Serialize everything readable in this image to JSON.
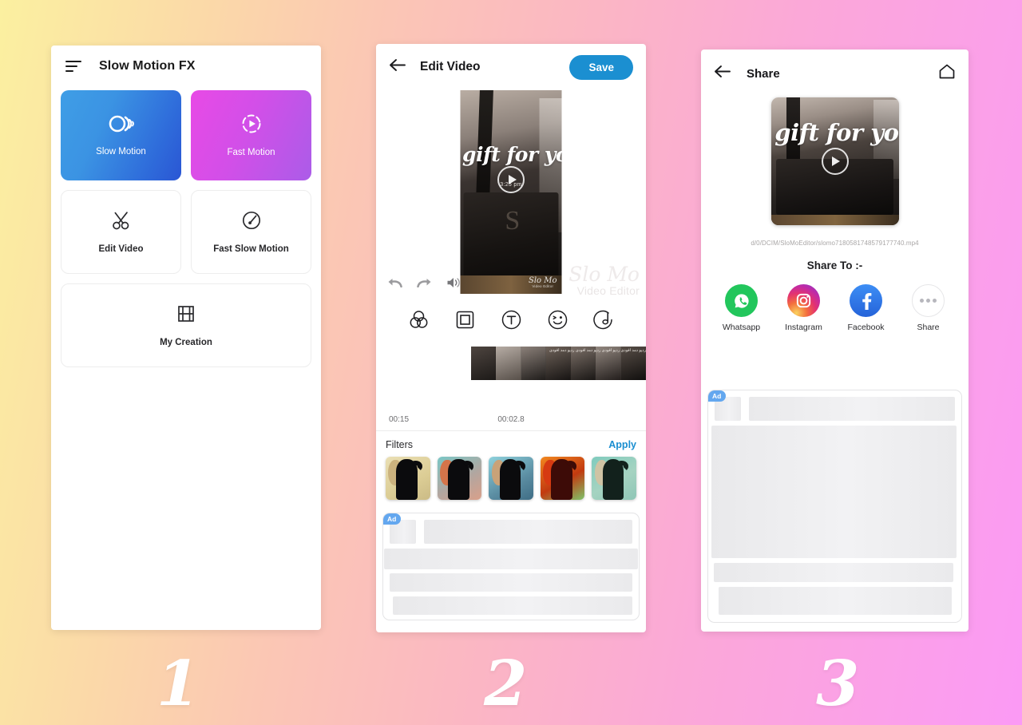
{
  "background": {
    "gradient_start": "#fbf0a0",
    "gradient_end": "#fb9af5"
  },
  "panel1": {
    "title": "Slow Motion FX",
    "menu_icon": "hamburger-icon",
    "cards": [
      {
        "label": "Slow Motion",
        "icon": "slow-motion-icon",
        "style": "gradient-blue",
        "color_from": "#3f9ee6",
        "color_to": "#2a56d4"
      },
      {
        "label": "Fast Motion",
        "icon": "fast-motion-icon",
        "style": "gradient-pink",
        "color_from": "#e84ae6",
        "color_to": "#ab5ce8"
      },
      {
        "label": "Edit Video",
        "icon": "scissors-icon",
        "style": "plain"
      },
      {
        "label": "Fast Slow Motion",
        "icon": "speedometer-icon",
        "style": "plain"
      },
      {
        "label": "My Creation",
        "icon": "film-strip-icon",
        "style": "plain-wide"
      }
    ]
  },
  "panel2": {
    "title": "Edit Video",
    "back_icon": "back-arrow-icon",
    "save_label": "Save",
    "save_color": "#1b8fd1",
    "video": {
      "overlay_text": "gift for you",
      "clock_text": "3:25 pm",
      "watermark_line1": "Slo Mo",
      "watermark_line2": "Video Editor",
      "play_icon": "play-icon"
    },
    "big_watermark": {
      "line1": "Slo Mo",
      "line2": "Video Editor"
    },
    "controls": [
      {
        "name": "undo-icon"
      },
      {
        "name": "redo-icon"
      },
      {
        "name": "volume-icon"
      }
    ],
    "tools": [
      {
        "name": "filter-icon",
        "label": "Filter"
      },
      {
        "name": "crop-icon",
        "label": "Crop"
      },
      {
        "name": "text-icon",
        "label": "Text"
      },
      {
        "name": "sticker-icon",
        "label": "Sticker"
      },
      {
        "name": "music-icon",
        "label": "Music"
      }
    ],
    "timeline": {
      "duration_label": "00:15",
      "current_label": "00:02.8",
      "playhead_color": "#1c8fc9",
      "strip_caption": "ردپو دمد افودى ردپو افودى ردپو دمد افودى ردپو دمد افودى"
    },
    "filters": {
      "title": "Filters",
      "apply_label": "Apply",
      "apply_color": "#1a8ed0",
      "thumbs": [
        {
          "name": "filter-warm-sepia",
          "bg_from": "#e6d9a8",
          "bg_to": "#d8c68d",
          "hair": "#cbb27e"
        },
        {
          "name": "filter-cool-teal",
          "bg_from": "#79c7c6",
          "bg_to": "#d9a08a",
          "hair": "#d4744a"
        },
        {
          "name": "filter-blue-cyan",
          "bg_from": "#7fc8d6",
          "bg_to": "#4e7f96",
          "hair": "#c9a278"
        },
        {
          "name": "filter-vivid-red",
          "bg_from": "#f07a1e",
          "bg_to": "#7ec46a",
          "hair": "#d63a12"
        },
        {
          "name": "filter-mint-green",
          "bg_from": "#74c9bc",
          "bg_to": "#9bd0be",
          "hair": "#cfc3a4"
        }
      ]
    },
    "ad": {
      "badge": "Ad"
    }
  },
  "panel3": {
    "title": "Share",
    "back_icon": "back-arrow-icon",
    "home_icon": "home-icon",
    "video": {
      "overlay_text": "gift for you",
      "play_icon": "play-icon"
    },
    "file_path": "d/0/DCIM/SloMoEditor/slomo7180581748579177740.mp4",
    "share_to_label": "Share To :-",
    "share_targets": [
      {
        "label": "Whatsapp",
        "icon": "whatsapp-icon",
        "color": "#22c65c"
      },
      {
        "label": "Instagram",
        "icon": "instagram-icon",
        "color": "#c32aa3"
      },
      {
        "label": "Facebook",
        "icon": "facebook-icon",
        "color": "#2563d9"
      },
      {
        "label": "Share",
        "icon": "more-dots-icon",
        "color": "#b7b7bd"
      }
    ],
    "ad": {
      "badge": "Ad"
    }
  },
  "steps": {
    "one": "1",
    "two": "2",
    "three": "3"
  }
}
